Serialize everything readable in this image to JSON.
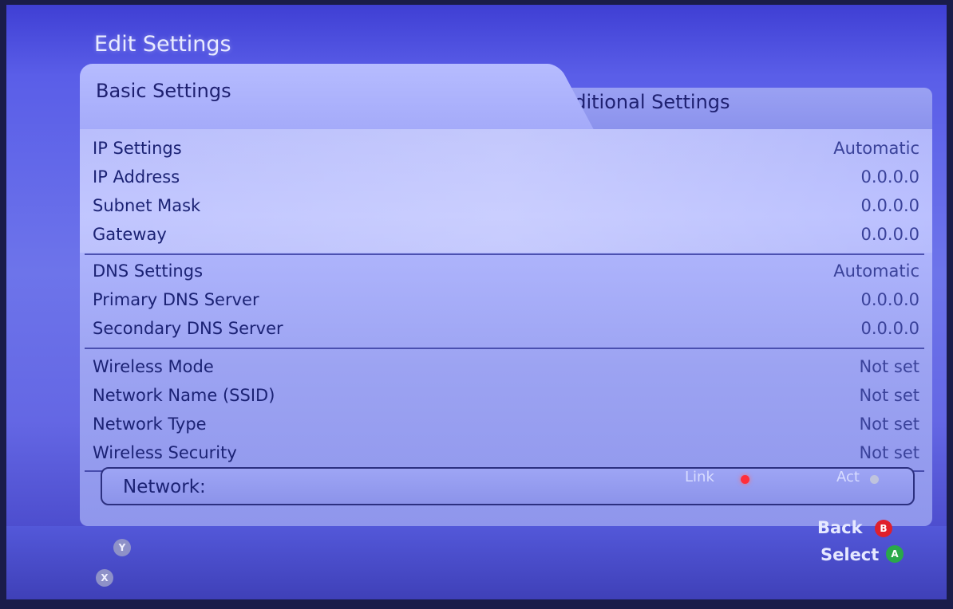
{
  "header": {
    "title": "Edit Settings"
  },
  "tabs": [
    {
      "label": "Basic Settings",
      "active": true
    },
    {
      "label": "Additional Settings",
      "active": false
    }
  ],
  "ip_group": [
    {
      "label": "IP Settings",
      "value": "Automatic"
    },
    {
      "label": "IP Address",
      "value": "0.0.0.0"
    },
    {
      "label": "Subnet Mask",
      "value": "0.0.0.0"
    },
    {
      "label": "Gateway",
      "value": "0.0.0.0"
    }
  ],
  "dns_group": [
    {
      "label": "DNS Settings",
      "value": "Automatic"
    },
    {
      "label": "Primary DNS Server",
      "value": "0.0.0.0"
    },
    {
      "label": "Secondary DNS Server",
      "value": "0.0.0.0"
    }
  ],
  "wireless_group": [
    {
      "label": "Wireless Mode",
      "value": "Not set"
    },
    {
      "label": "Network Name (SSID)",
      "value": "Not set"
    },
    {
      "label": "Network Type",
      "value": "Not set"
    },
    {
      "label": "Wireless Security",
      "value": "Not set"
    }
  ],
  "network_status": {
    "label": "Network:",
    "link_label": "Link",
    "act_label": "Act",
    "link_color": "#ff2e3a",
    "act_color": "#bfc3dd"
  },
  "footer": {
    "y_button": "Y",
    "x_button": "X",
    "back_label": "Back",
    "back_button": "B",
    "select_label": "Select",
    "select_button": "A"
  }
}
